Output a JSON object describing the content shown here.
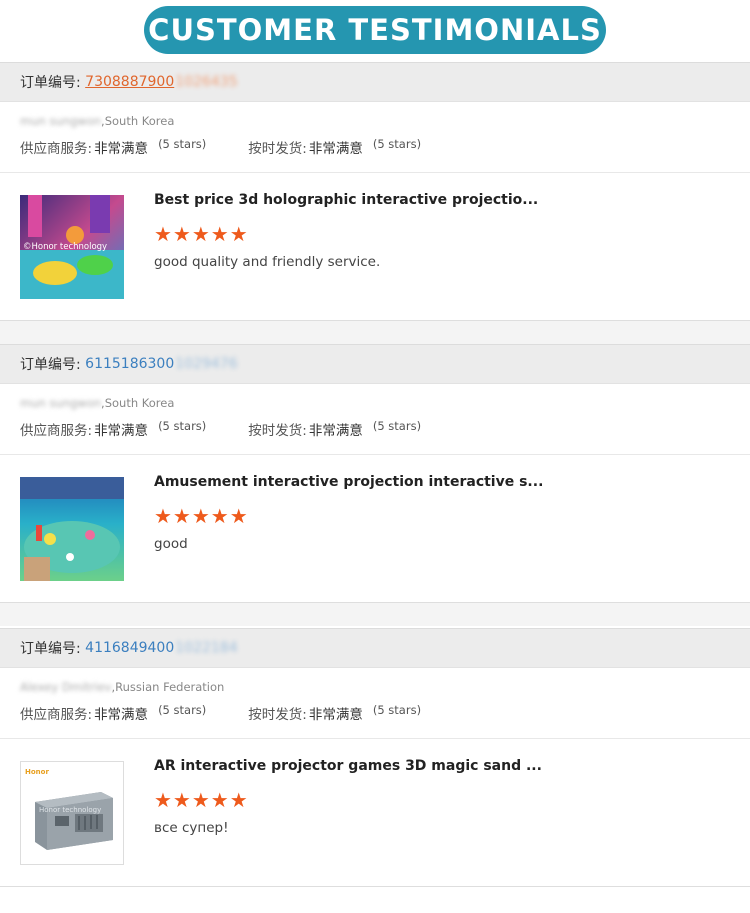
{
  "banner": {
    "title": "CUSTOMER TESTIMONIALS"
  },
  "reviews": [
    {
      "order_label": "订单编号:",
      "order_number": "7308887900",
      "order_number_hidden": "1026435",
      "buyer_hidden": "mun sungwon",
      "buyer_country": ",South Korea",
      "supplier_service_label": "供应商服务:",
      "supplier_service_value": "非常满意",
      "supplier_service_stars": "(5 stars)",
      "ontime_label": "按时发货:",
      "ontime_value": "非常满意",
      "ontime_stars": "(5 stars)",
      "product_title": "Best price 3d holographic interactive projectio...",
      "rating": "★★★★★",
      "comment": "good quality and friendly service.",
      "thumb_caption": "©Honor technology"
    },
    {
      "order_label": "订单编号:",
      "order_number": "6115186300",
      "order_number_hidden": "1029476",
      "buyer_hidden": "mun sungwon",
      "buyer_country": ",South Korea",
      "supplier_service_label": "供应商服务:",
      "supplier_service_value": "非常满意",
      "supplier_service_stars": "(5 stars)",
      "ontime_label": "按时发货:",
      "ontime_value": "非常满意",
      "ontime_stars": "(5 stars)",
      "product_title": "Amusement interactive projection interactive s...",
      "rating": "★★★★★",
      "comment": "good"
    },
    {
      "order_label": "订单编号:",
      "order_number": "4116849400",
      "order_number_hidden": "1022184",
      "buyer_hidden": "Alexey Dmitriev",
      "buyer_country": ",Russian Federation",
      "supplier_service_label": "供应商服务:",
      "supplier_service_value": "非常满意",
      "supplier_service_stars": "(5 stars)",
      "ontime_label": "按时发货:",
      "ontime_value": "非常满意",
      "ontime_stars": "(5 stars)",
      "product_title": "AR interactive projector games 3D magic sand ...",
      "rating": "★★★★★",
      "comment": "все супер!",
      "thumb_caption": "Honor technology"
    }
  ],
  "colors": {
    "banner": "#2596b0",
    "order_link": "#3b7fbf",
    "order_link_highlight": "#e0662d",
    "stars": "#ee5a1c"
  }
}
